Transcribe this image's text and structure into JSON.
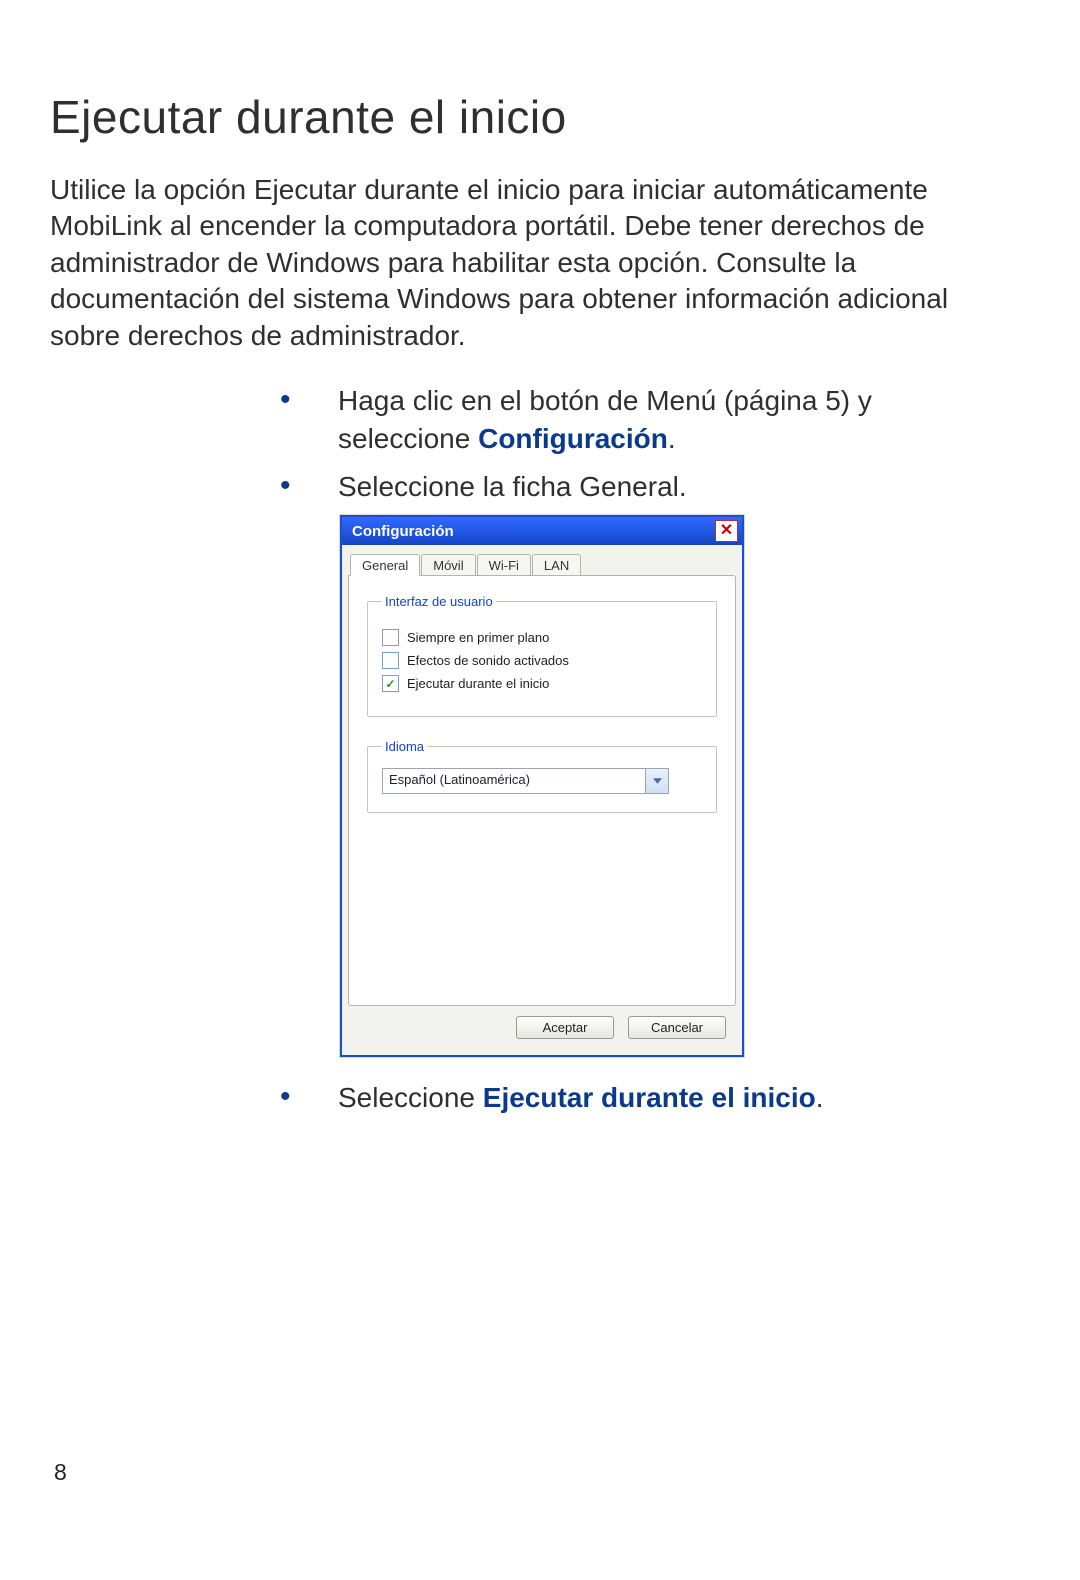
{
  "heading": "Ejecutar durante el inicio",
  "intro": "Utilice la opción Ejecutar durante el inicio para iniciar automáticamente MobiLink al encender la computadora portátil. Debe tener derechos de administrador de Windows para habilitar esta opción. Consulte la documentación del sistema Windows para obtener información adicional sobre derechos de administrador.",
  "steps": [
    {
      "pre": "Haga clic en el botón de Menú (página 5) y seleccione ",
      "bold": "Configuración",
      "post": "."
    },
    {
      "pre": "Seleccione la ficha General.",
      "bold": "",
      "post": ""
    },
    {
      "pre": "Seleccione ",
      "bold": "Ejecutar durante el inicio",
      "post": "."
    }
  ],
  "dialog": {
    "title": "Configuración",
    "tabs": [
      "General",
      "Móvil",
      "Wi-Fi",
      "LAN"
    ],
    "active_tab": "General",
    "group_ui_legend": "Interfaz de usuario",
    "checks": [
      {
        "label": "Siempre en primer plano",
        "checked": false
      },
      {
        "label": "Efectos de sonido activados",
        "checked": false
      },
      {
        "label": "Ejecutar durante el inicio",
        "checked": true
      }
    ],
    "group_lang_legend": "Idioma",
    "language_value": "Español (Latinoamérica)",
    "ok_label": "Aceptar",
    "cancel_label": "Cancelar"
  },
  "page_number": "8"
}
